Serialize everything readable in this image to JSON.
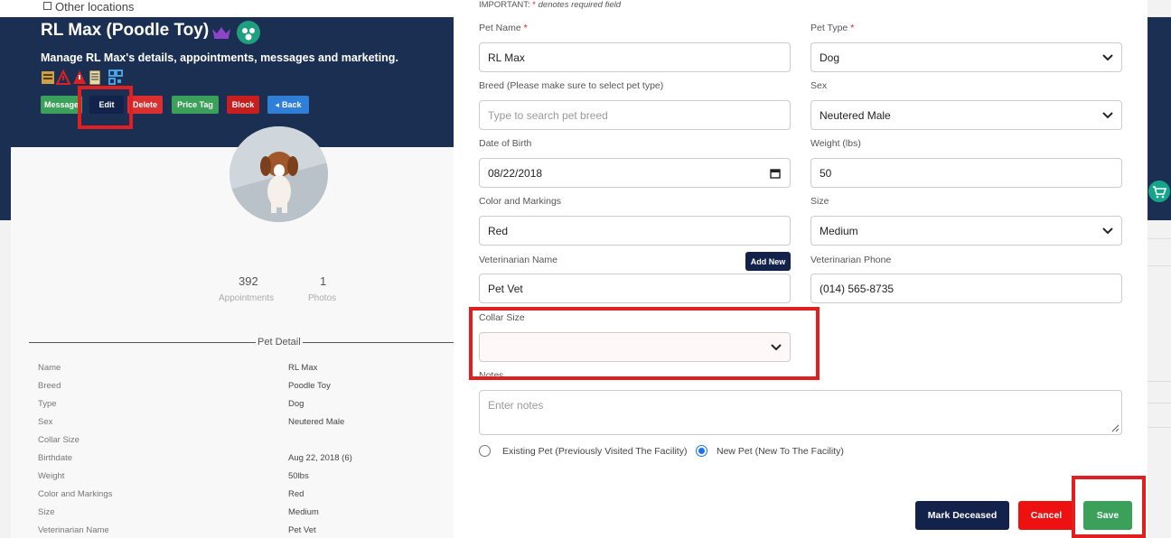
{
  "background": {
    "top_filter_label": "Other locations",
    "pet_title": "RL Max (Poodle Toy)",
    "subtitle": "Manage RL Max's details, appointments, messages and marketing.",
    "action_buttons": [
      {
        "label": "Message",
        "color": "#3aa05a"
      },
      {
        "label": "Edit",
        "color": "#13224b"
      },
      {
        "label": "Delete",
        "color": "#d92f2f"
      },
      {
        "label": "Price Tag",
        "color": "#3aa05a"
      },
      {
        "label": "Block",
        "color": "#c81e1e"
      },
      {
        "label": "Back",
        "color": "#2f7fd9"
      }
    ],
    "stats": [
      {
        "value": "392",
        "label": "Appointments"
      },
      {
        "value": "1",
        "label": "Photos"
      }
    ],
    "pet_detail_title": "Pet Detail",
    "details": [
      {
        "label": "Name",
        "value": "RL Max"
      },
      {
        "label": "Breed",
        "value": "Poodle Toy"
      },
      {
        "label": "Type",
        "value": "Dog"
      },
      {
        "label": "Sex",
        "value": "Neutered Male"
      },
      {
        "label": "Collar Size",
        "value": ""
      },
      {
        "label": "Birthdate",
        "value": "Aug 22, 2018  (6)"
      },
      {
        "label": "Weight",
        "value": "50lbs"
      },
      {
        "label": "Color and Markings",
        "value": "Red"
      },
      {
        "label": "Size",
        "value": "Medium"
      },
      {
        "label": "Veterinarian Name",
        "value": "Pet Vet"
      }
    ]
  },
  "modal": {
    "important_prefix": "IMPORTANT:",
    "important_star": "*",
    "important_note": "denotes required field",
    "pet_name": {
      "label": "Pet Name",
      "value": "RL Max"
    },
    "pet_type": {
      "label": "Pet Type",
      "value": "Dog"
    },
    "breed": {
      "label": "Breed (Please make sure to select pet type)",
      "placeholder": "Type to search pet breed"
    },
    "sex": {
      "label": "Sex",
      "value": "Neutered Male"
    },
    "dob": {
      "label": "Date of Birth",
      "value": "08/22/2018"
    },
    "weight": {
      "label": "Weight (lbs)",
      "value": "50"
    },
    "color": {
      "label": "Color and Markings",
      "value": "Red"
    },
    "size": {
      "label": "Size",
      "value": "Medium"
    },
    "vet_name": {
      "label": "Veterinarian Name",
      "value": "Pet Vet",
      "add_new": "Add New"
    },
    "vet_phone": {
      "label": "Veterinarian Phone",
      "value": "(014) 565-8735"
    },
    "collar_size": {
      "label": "Collar Size",
      "value": ""
    },
    "notes": {
      "label": "Notes",
      "placeholder": "Enter notes"
    },
    "radio_existing": "Existing Pet (Previously Visited The Facility)",
    "radio_new": "New Pet (New To The Facility)",
    "btn_mark_deceased": "Mark Deceased",
    "btn_cancel": "Cancel",
    "btn_save": "Save"
  }
}
